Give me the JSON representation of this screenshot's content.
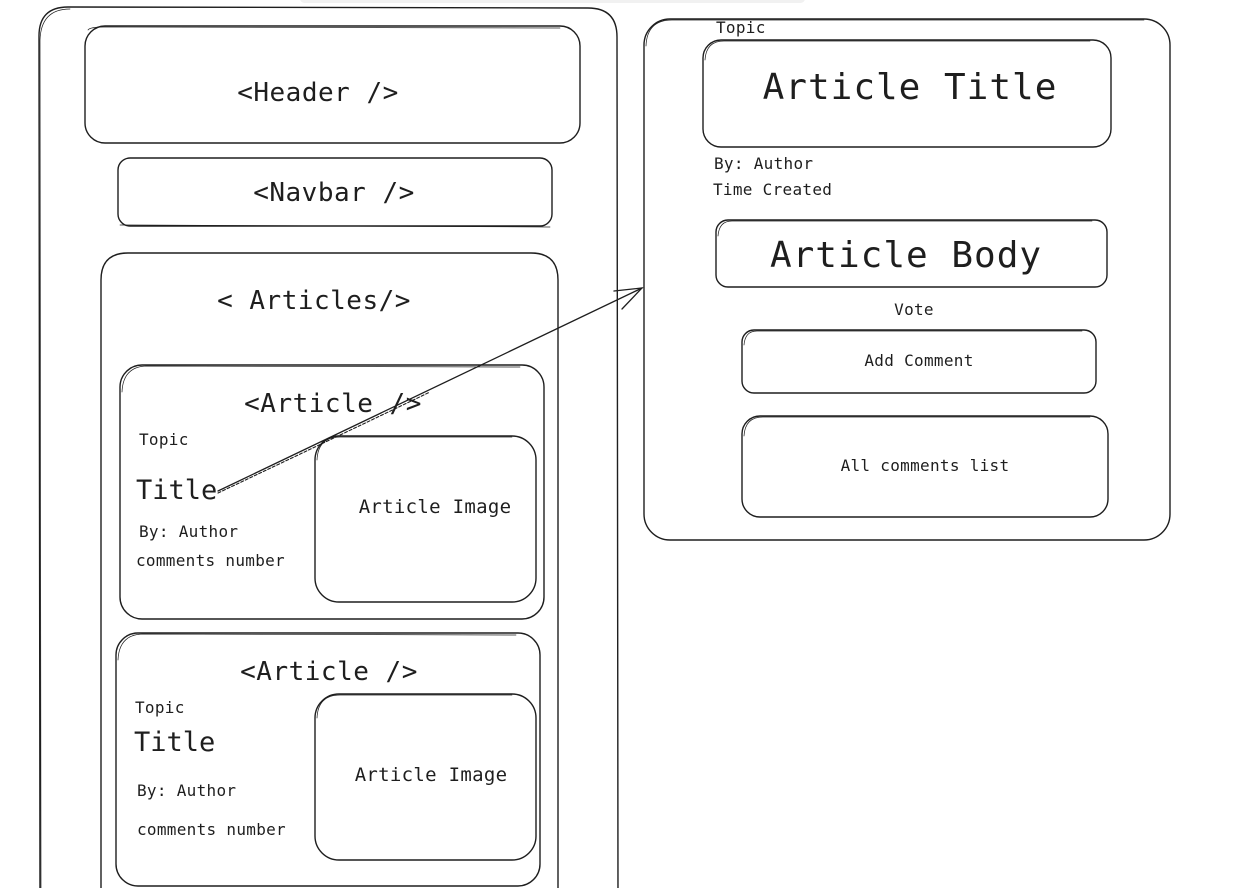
{
  "app": {
    "page": {
      "header_label": "<Header />",
      "navbar_label": "<Navbar />",
      "articles_label": "< Articles/>",
      "articles": [
        {
          "tag": "<Article />",
          "topic": "Topic",
          "title": "Title",
          "author": "By: Author",
          "comments": "comments number",
          "image": "Article Image"
        },
        {
          "tag": "<Article />",
          "topic": "Topic",
          "title": "Title",
          "author": "By: Author",
          "comments": "comments number",
          "image": "Article Image"
        }
      ]
    },
    "detail": {
      "topic": "Topic",
      "title": "Article Title",
      "author": "By: Author",
      "time_created": "Time Created",
      "body": "Article Body",
      "vote": "Vote",
      "add_comment": "Add Comment",
      "comments_list": "All comments list"
    }
  },
  "colors": {
    "stroke": "#1e1e1e",
    "background": "#ffffff",
    "toolbar": "#f1f1f1"
  }
}
